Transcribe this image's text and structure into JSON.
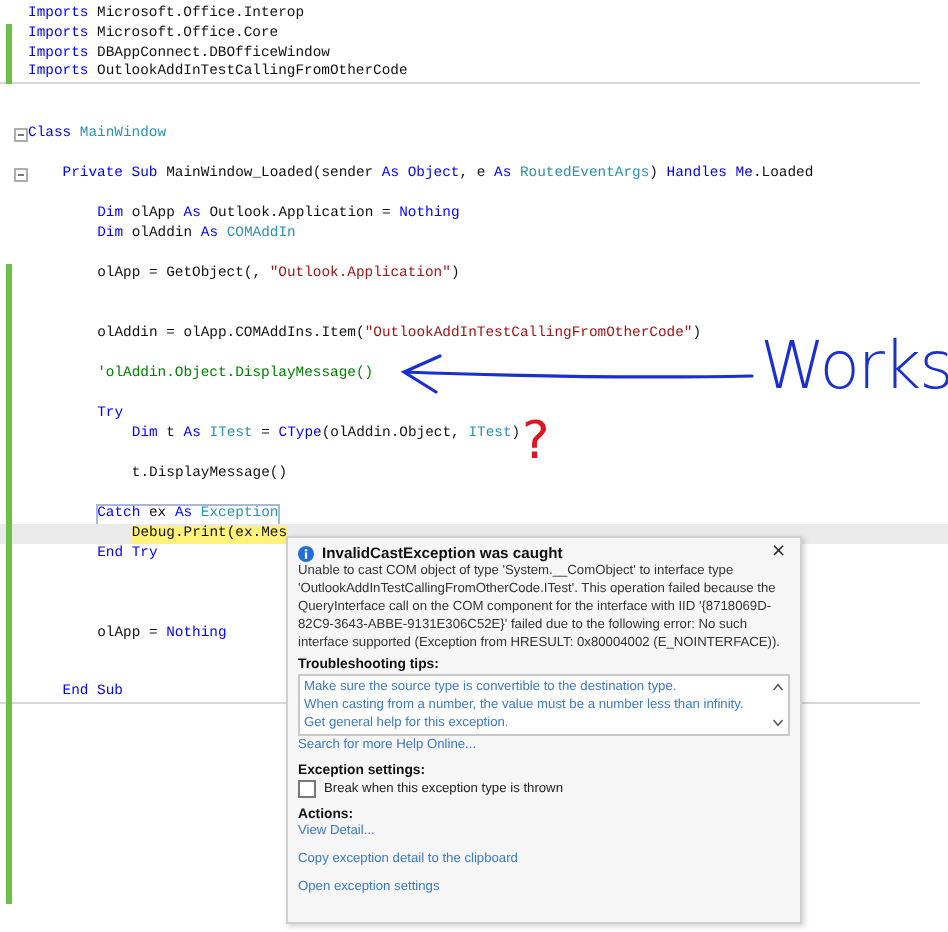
{
  "lines": [
    {
      "kind": "code",
      "changed": false,
      "tokens": [
        {
          "kind": "kw",
          "s": "Imports"
        },
        {
          "kind": "plain",
          "s": " Microsoft.Office.Interop"
        }
      ]
    },
    {
      "kind": "code",
      "changed": true,
      "tokens": [
        {
          "kind": "kw",
          "s": "Imports"
        },
        {
          "kind": "plain",
          "s": " Microsoft.Office.Core"
        }
      ]
    },
    {
      "kind": "code",
      "changed": true,
      "tokens": [
        {
          "kind": "kw",
          "s": "Imports"
        },
        {
          "kind": "plain",
          "s": " DBAppConnect.DBOfficeWindow"
        }
      ]
    },
    {
      "kind": "code",
      "changed": true,
      "separator": true,
      "tokens": [
        {
          "kind": "kw",
          "s": "Imports"
        },
        {
          "kind": "plain",
          "s": " OutlookAddInTestCallingFromOtherCode"
        }
      ]
    },
    {
      "kind": "blank",
      "changed": false
    },
    {
      "kind": "blank",
      "changed": false
    },
    {
      "kind": "code",
      "changed": false,
      "collapsible": true,
      "tokens": [
        {
          "kind": "kw",
          "s": "Class"
        },
        {
          "kind": "type",
          "s": " MainWindow"
        }
      ],
      "children": [
        {
          "kind": "blank",
          "changed": false
        },
        {
          "kind": "code",
          "changed": false,
          "collapsible": true,
          "tokens": [
            {
              "kind": "kw",
              "s": "Private Sub"
            },
            {
              "kind": "plain",
              "s": " MainWindow_Loaded(sender "
            },
            {
              "kind": "kw",
              "s": "As Object"
            },
            {
              "kind": "plain",
              "s": ", e "
            },
            {
              "kind": "kw",
              "s": "As"
            },
            {
              "kind": "type",
              "s": " RoutedEventArgs"
            },
            {
              "kind": "plain",
              "s": ") "
            },
            {
              "kind": "kw",
              "s": "Handles Me"
            },
            {
              "kind": "plain",
              "s": ".Loaded"
            }
          ],
          "children": [
            {
              "kind": "blank",
              "changed": false
            },
            {
              "kind": "code",
              "changed": false,
              "tokens": [
                {
                  "kind": "kw",
                  "s": "Dim"
                },
                {
                  "kind": "plain",
                  "s": " olApp "
                },
                {
                  "kind": "kw",
                  "s": "As"
                },
                {
                  "kind": "plain",
                  "s": " Outlook.Application = "
                },
                {
                  "kind": "kw",
                  "s": "Nothing"
                }
              ]
            },
            {
              "kind": "code",
              "changed": false,
              "tokens": [
                {
                  "kind": "kw",
                  "s": "Dim"
                },
                {
                  "kind": "plain",
                  "s": " olAddin "
                },
                {
                  "kind": "kw",
                  "s": "As"
                },
                {
                  "kind": "type",
                  "s": " COMAddIn"
                }
              ]
            },
            {
              "kind": "blank",
              "changed": false
            },
            {
              "kind": "code",
              "changed": true,
              "tokens": [
                {
                  "kind": "plain",
                  "s": "olApp = GetObject(, "
                },
                {
                  "kind": "str",
                  "s": "\"Outlook.Application\""
                },
                {
                  "kind": "plain",
                  "s": ")"
                }
              ]
            },
            {
              "kind": "blank",
              "changed": true
            },
            {
              "kind": "blank",
              "changed": true
            },
            {
              "kind": "code",
              "changed": true,
              "tokens": [
                {
                  "kind": "plain",
                  "s": "olAddin = olApp.COMAddIns.Item("
                },
                {
                  "kind": "str",
                  "s": "\"OutlookAddInTestCallingFromOtherCode\""
                },
                {
                  "kind": "plain",
                  "s": ")"
                }
              ]
            },
            {
              "kind": "blank",
              "changed": true
            },
            {
              "kind": "code",
              "changed": true,
              "tokens": [
                {
                  "kind": "comment",
                  "s": "'olAddin.Object.DisplayMessage()"
                }
              ]
            },
            {
              "kind": "blank",
              "changed": true
            },
            {
              "kind": "code",
              "changed": true,
              "tokens": [
                {
                  "kind": "kw",
                  "s": "Try"
                }
              ],
              "children": [
                {
                  "kind": "code",
                  "changed": true,
                  "tokens": [
                    {
                      "kind": "kw",
                      "s": "Dim"
                    },
                    {
                      "kind": "plain",
                      "s": " t "
                    },
                    {
                      "kind": "kw",
                      "s": "As"
                    },
                    {
                      "kind": "type",
                      "s": " ITest"
                    },
                    {
                      "kind": "plain",
                      "s": " = "
                    },
                    {
                      "kind": "kw",
                      "s": "CType"
                    },
                    {
                      "kind": "plain",
                      "s": "(olAddin.Object, "
                    },
                    {
                      "kind": "type",
                      "s": "ITest"
                    },
                    {
                      "kind": "plain",
                      "s": ")"
                    }
                  ]
                },
                {
                  "kind": "blank",
                  "changed": true
                },
                {
                  "kind": "code",
                  "changed": true,
                  "tokens": [
                    {
                      "kind": "plain",
                      "s": "t.DisplayMessage()"
                    }
                  ]
                },
                {
                  "kind": "blank",
                  "changed": true
                }
              ]
            },
            {
              "kind": "code",
              "changed": true,
              "boxed": true,
              "tokens": [
                {
                  "kind": "kw",
                  "s": "Catch"
                },
                {
                  "kind": "plain",
                  "s": " ex "
                },
                {
                  "kind": "kw",
                  "s": "As"
                },
                {
                  "kind": "type",
                  "s": " Exception"
                }
              ],
              "children": [
                {
                  "kind": "code",
                  "changed": true,
                  "current": true,
                  "tokens": [
                    {
                      "kind": "plain",
                      "s": "Debug.Print(ex.Mes"
                    }
                  ]
                }
              ]
            },
            {
              "kind": "code",
              "changed": true,
              "tokens": [
                {
                  "kind": "kw",
                  "s": "End Try"
                }
              ]
            },
            {
              "kind": "blank",
              "changed": true
            },
            {
              "kind": "blank",
              "changed": true
            },
            {
              "kind": "blank",
              "changed": true
            },
            {
              "kind": "code",
              "changed": true,
              "tokens": [
                {
                  "kind": "plain",
                  "s": "olApp = "
                },
                {
                  "kind": "kw",
                  "s": "Nothing"
                }
              ]
            },
            {
              "kind": "blank",
              "changed": true
            },
            {
              "kind": "blank",
              "changed": true
            }
          ]
        },
        {
          "kind": "code",
          "changed": true,
          "separator": true,
          "tokens": [
            {
              "kind": "kw",
              "s": "End Sub"
            }
          ]
        }
      ]
    },
    {
      "kind": "blank",
      "changed": true
    },
    {
      "kind": "blank",
      "changed": true
    },
    {
      "kind": "blank",
      "changed": true
    },
    {
      "kind": "blank",
      "changed": true
    },
    {
      "kind": "blank",
      "changed": true
    },
    {
      "kind": "blank",
      "changed": true
    },
    {
      "kind": "blank",
      "changed": true
    },
    {
      "kind": "blank",
      "changed": true
    },
    {
      "kind": "blank",
      "changed": true
    },
    {
      "kind": "blank",
      "changed": true
    }
  ],
  "annotations": {
    "works": "Works",
    "question": "?"
  },
  "popup": {
    "title": "InvalidCastException was caught",
    "close": "×",
    "message": "Unable to cast COM object of type 'System.__ComObject' to interface type 'OutlookAddInTestCallingFromOtherCode.ITest'. This operation failed because the QueryInterface call on the COM component for the interface with IID '{8718069D-82C9-3643-ABBE-9131E306C52E}' failed due to the following error: No such interface supported (Exception from HRESULT: 0x80004002 (E_NOINTERFACE)).",
    "tips_heading": "Troubleshooting tips:",
    "tips": [
      "Make sure the source type is convertible to the destination type.",
      "When casting from a number, the value must be a number less than infinity.",
      "Get general help for this exception."
    ],
    "search_link": "Search for more Help Online...",
    "settings_heading": "Exception settings:",
    "break_option": {
      "label": "Break when this exception type is thrown",
      "checked": false
    },
    "actions_heading": "Actions:",
    "actions": [
      "View Detail...",
      "Copy exception detail to the clipboard",
      "Open exception settings"
    ]
  }
}
